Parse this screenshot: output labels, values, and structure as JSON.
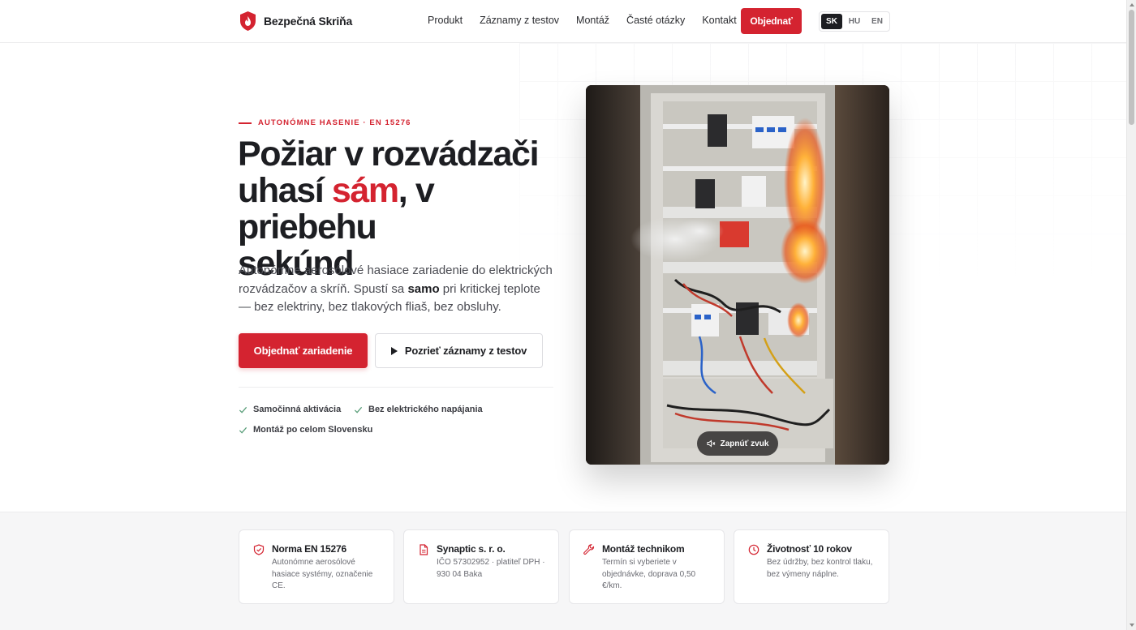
{
  "brand": {
    "name": "Bezpečná Skriňa",
    "icon": "shield-flame-icon",
    "color": "#d42330"
  },
  "nav": {
    "items": [
      "Produkt",
      "Záznamy z testov",
      "Montáž",
      "Časté otázky",
      "Kontakt"
    ],
    "order_label": "Objednať"
  },
  "languages": {
    "items": [
      "SK",
      "HU",
      "EN"
    ],
    "active": "SK"
  },
  "hero": {
    "eyebrow": "AUTONÓMNE HASENIE · EN 15276",
    "headline_line1": "Požiar v rozvádzači",
    "headline_line2_pre": "uhasí ",
    "headline_accent": "sám",
    "headline_line2_post": ", v priebehu",
    "headline_line3": "sekúnd",
    "lead_pre": "Autonómne aerosólové hasiace zariadenie do elektrických rozvádzačov a skríň. Spustí sa ",
    "lead_bold": "samo",
    "lead_post": " pri kritickej teplote — bez elektriny, bez tlakových fliaš, bez obsluhy.",
    "primary_button": "Objednať zariadenie",
    "secondary_button": "Pozrieť záznamy z testov",
    "features": [
      "Samočinná aktivácia",
      "Bez elektrického napájania",
      "Montáž po celom Slovensku"
    ]
  },
  "video": {
    "sound_button": "Zapnúť zvuk",
    "sound_icon": "speaker-muted-icon"
  },
  "cards": [
    {
      "icon": "shield-check-icon",
      "title": "Norma EN 15276",
      "text": "Autonómne aerosólové hasiace systémy, označenie CE."
    },
    {
      "icon": "document-icon",
      "title": "Synaptic s. r. o.",
      "text": "IČO 57302952 · platiteľ DPH · 930 04 Baka"
    },
    {
      "icon": "wrench-icon",
      "title": "Montáž technikom",
      "text": "Termín si vyberiete v objednávke, doprava 0,50 €/km."
    },
    {
      "icon": "clock-icon",
      "title": "Životnosť 10 rokov",
      "text": "Bez údržby, bez kontrol tlaku, bez výmeny náplne."
    }
  ]
}
